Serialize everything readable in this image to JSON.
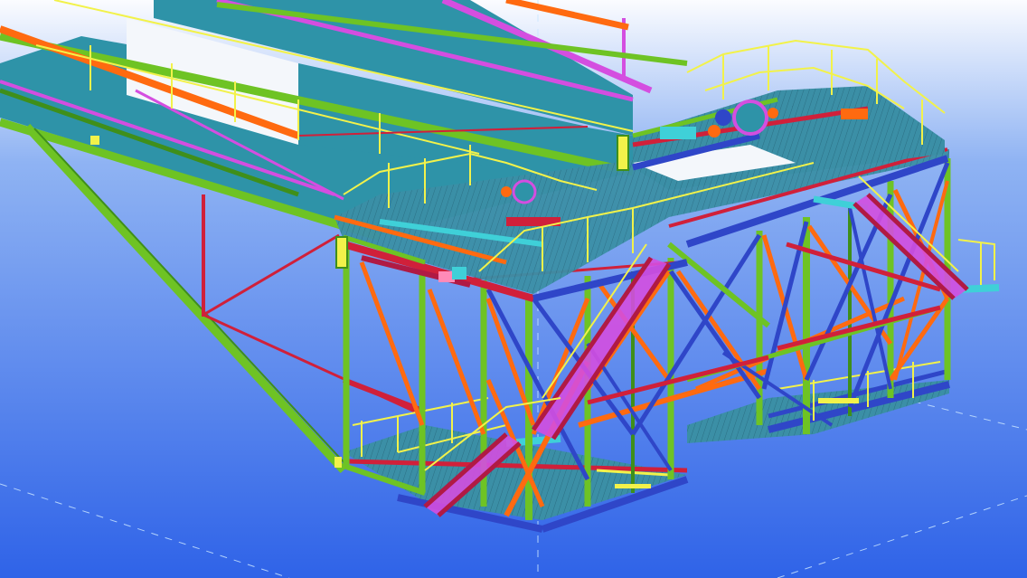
{
  "viewport": {
    "background_top": "#fbfcff",
    "background_mid": "#8fb3f3",
    "background_bottom": "#2f63e8"
  },
  "model": {
    "colors": {
      "green": "#6ec324",
      "dark_green": "#3f8f1a",
      "orange": "#ff6a10",
      "blue": "#2f46c8",
      "red": "#d0203a",
      "crimson": "#b01a44",
      "yellow": "#f2f24a",
      "magenta": "#d44ee0",
      "teal": "#2e93a8",
      "cyan": "#3fd0d8",
      "pink": "#ff8ab8",
      "white": "#f4f7fb"
    }
  }
}
